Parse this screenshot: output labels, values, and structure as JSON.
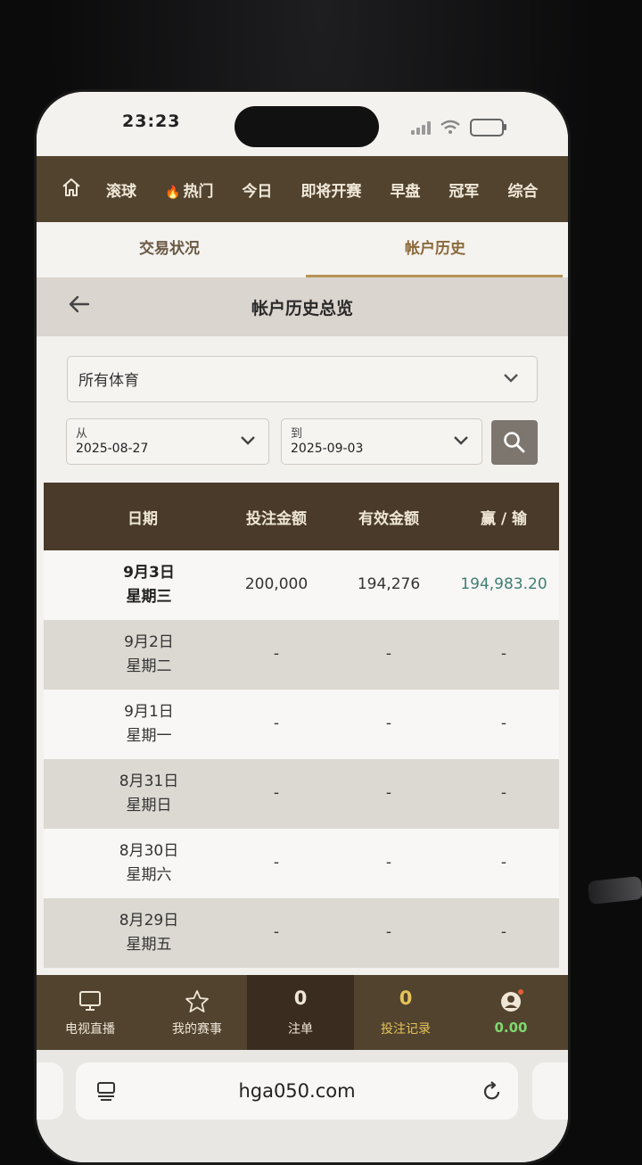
{
  "status_bar": {
    "time": "23:23"
  },
  "nav": {
    "items": [
      "滚球",
      "热门",
      "今日",
      "即将开赛",
      "早盘",
      "冠军",
      "综合"
    ]
  },
  "tabs": {
    "trade_status": "交易状况",
    "account_history": "帐户历史"
  },
  "subheader": {
    "title": "帐户历史总览"
  },
  "filters": {
    "sport_select": "所有体育",
    "from_label": "从",
    "from_date": "2025-08-27",
    "to_label": "到",
    "to_date": "2025-09-03"
  },
  "table": {
    "headers": [
      "日期",
      "投注金额",
      "有效金额",
      "赢 / 输"
    ],
    "rows": [
      {
        "date": "9月3日",
        "weekday": "星期三",
        "bet": "200,000",
        "valid": "194,276",
        "winloss": "194,983.20"
      },
      {
        "date": "9月2日",
        "weekday": "星期二",
        "bet": "-",
        "valid": "-",
        "winloss": "-"
      },
      {
        "date": "9月1日",
        "weekday": "星期一",
        "bet": "-",
        "valid": "-",
        "winloss": "-"
      },
      {
        "date": "8月31日",
        "weekday": "星期日",
        "bet": "-",
        "valid": "-",
        "winloss": "-"
      },
      {
        "date": "8月30日",
        "weekday": "星期六",
        "bet": "-",
        "valid": "-",
        "winloss": "-"
      },
      {
        "date": "8月29日",
        "weekday": "星期五",
        "bet": "-",
        "valid": "-",
        "winloss": "-"
      }
    ]
  },
  "bottom_bar": {
    "tv_live": "电视直播",
    "my_events": "我的赛事",
    "betslip_count": "0",
    "betslip": "注单",
    "bet_records_count": "0",
    "bet_records": "投注记录",
    "balance": "0.00"
  },
  "browser": {
    "url": "hga050.com"
  },
  "colors": {
    "brand_brown": "#52432f",
    "accent_gold": "#b59358",
    "win_green": "#3f7f73",
    "balance_green": "#7ed870"
  }
}
